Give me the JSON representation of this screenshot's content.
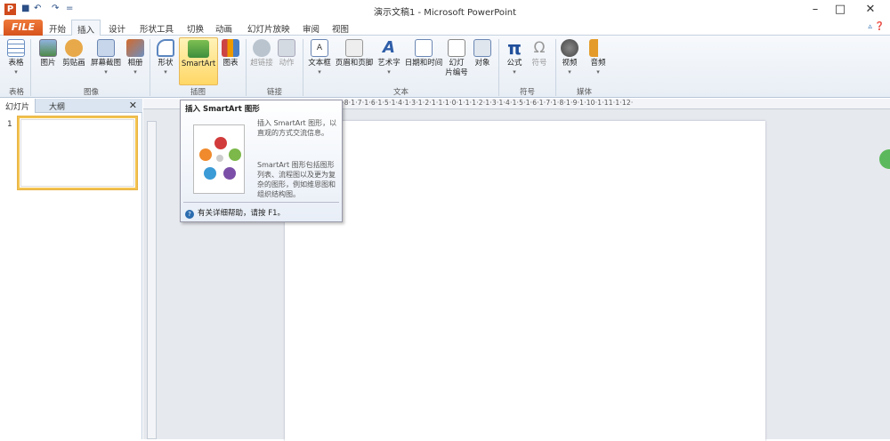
{
  "window": {
    "title": "演示文稿1 - Microsoft PowerPoint",
    "app_icon_letter": "P"
  },
  "quick_access": {
    "undo": "↶",
    "redo": "↷",
    "customize": "="
  },
  "window_buttons": {
    "minimize": "–",
    "maximize": "□",
    "close": "✕"
  },
  "tabs": {
    "file": "开始",
    "items": [
      "开始",
      "插入",
      "设计",
      "形状工具",
      "切换",
      "动画",
      "幻灯片放映",
      "审阅",
      "视图"
    ],
    "active": "插入"
  },
  "ribbon": {
    "buttons": {
      "table": "表格",
      "picture": "图片",
      "clipart": "剪贴画",
      "screenshot": "屏幕截图",
      "album": "相册",
      "shapes": "形状",
      "smartart": "SmartArt",
      "chart": "图表",
      "hyperlink": "超链接",
      "action": "动作",
      "textbox": "文本框",
      "header_footer": "页眉和页脚",
      "wordart": "艺术字",
      "datetime": "日期和时间",
      "slide_number_1": "幻灯",
      "slide_number_2": "片编号",
      "object": "对象",
      "equation": "公式",
      "symbol": "符号",
      "video": "视频",
      "audio": "音频"
    },
    "groups": {
      "tables": "表格",
      "images": "图像",
      "illustrations": "插图",
      "links": "链接",
      "text": "文本",
      "symbols": "符号",
      "media": "媒体"
    }
  },
  "left_panel": {
    "tab_slides": "幻灯片",
    "tab_outline": "大纲",
    "close": "✕",
    "slide_number": "1"
  },
  "ruler": {
    "horizontal_labels": "·9·1·8·1·7·1·6·1·5·1·4·1·3·1·2·1·1·1·0·1·1·1·2·1·3·1·4·1·5·1·6·1·7·1·8·1·9·1·10·1·11·1·12·"
  },
  "tooltip": {
    "title": "插入 SmartArt 图形",
    "desc1": "插入 SmartArt 图形，以直观的方式交流信息。",
    "desc2": "SmartArt 图形包括图形列表、流程图以及更为复杂的图形，例如维恩图和组织结构图。",
    "help_text": "有关详细帮助，请按 F1。"
  },
  "colors": {
    "accent": "#d6521c",
    "ribbon_highlight": "#ffd766",
    "selection": "#f3c34e"
  }
}
